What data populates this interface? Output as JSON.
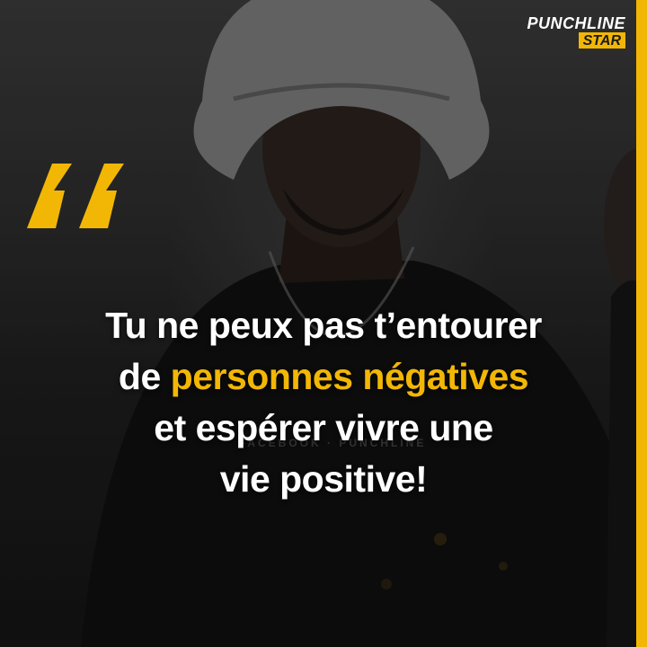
{
  "brand": {
    "line1": "PUNCHLINE",
    "line2": "STAR",
    "accent_color": "#f2b705"
  },
  "quote": {
    "line1": "Tu ne peux pas t’entourer",
    "line2_prefix": "de ",
    "line2_highlight": "personnes négatives",
    "line3": "et espérer vivre une",
    "line4": "vie positive!"
  },
  "watermark": "FACEBOOK · PUNCHLINE",
  "icons": {
    "quote_mark": "quote-open-icon"
  }
}
